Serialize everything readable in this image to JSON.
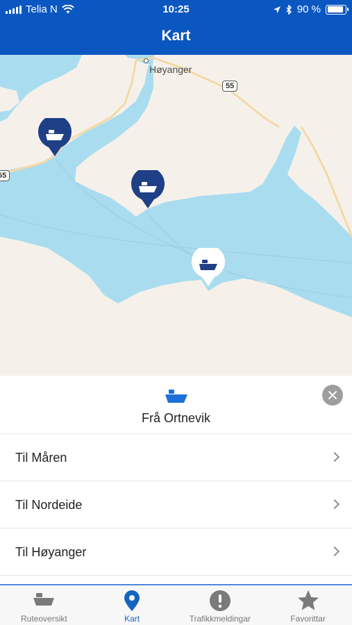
{
  "status_bar": {
    "carrier": "Telia N",
    "time": "10:25",
    "battery": "90 %",
    "battery_level": 0.9
  },
  "header": {
    "title": "Kart"
  },
  "map": {
    "place_label": "Høyanger",
    "road_badges": [
      "55",
      "55"
    ],
    "pins": [
      {
        "name": "ferry-pin-1",
        "active": false
      },
      {
        "name": "ferry-pin-2",
        "active": false
      },
      {
        "name": "ferry-pin-3",
        "active": true
      }
    ]
  },
  "sheet": {
    "title": "Frå Ortnevik",
    "routes": [
      {
        "label": "Til Måren"
      },
      {
        "label": "Til Nordeide"
      },
      {
        "label": "Til Høyanger"
      }
    ]
  },
  "tabs": [
    {
      "label": "Ruteoversikt",
      "icon": "ferry-icon",
      "active": false
    },
    {
      "label": "Kart",
      "icon": "map-pin-icon",
      "active": true
    },
    {
      "label": "Trafikkmeldingar",
      "icon": "alert-icon",
      "active": false
    },
    {
      "label": "Favorittar",
      "icon": "star-icon",
      "active": false
    }
  ],
  "colors": {
    "brand": "#0b57c1",
    "water": "#aadcef",
    "land": "#f5f1ea",
    "pin": "#1f3f86",
    "tab_active": "#1565c0",
    "tab_inactive": "#777777"
  }
}
